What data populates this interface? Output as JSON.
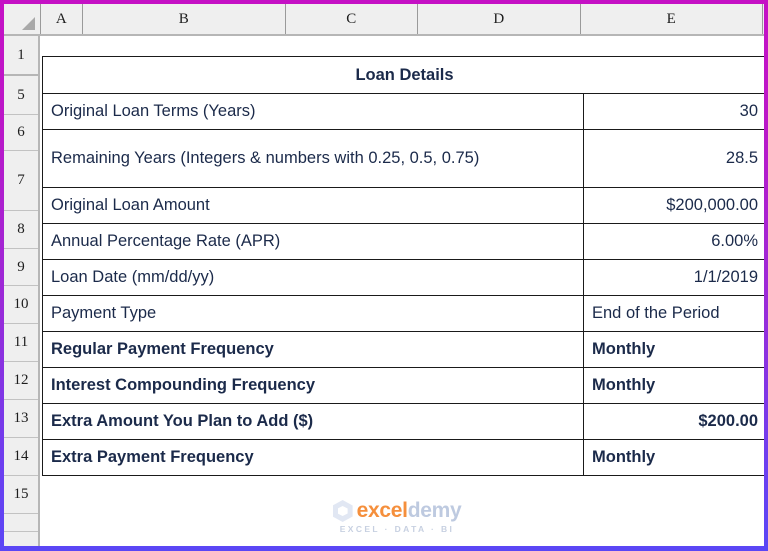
{
  "spreadsheet": {
    "column_headers": [
      "A",
      "B",
      "C",
      "D",
      "E"
    ],
    "row_headers": [
      "1",
      "5",
      "6",
      "7",
      "8",
      "9",
      "10",
      "11",
      "12",
      "13",
      "14",
      "15"
    ],
    "select_all_icon": "select-all-triangle"
  },
  "table": {
    "title": "Loan Details",
    "title_bg": "#FBE1A0",
    "highlight_color": "#FA8B12",
    "text_color": "#1B2A4A",
    "rows": [
      {
        "label": "Original Loan Terms (Years)",
        "value": "30",
        "highlight": false,
        "align": "right",
        "tall": false
      },
      {
        "label": "Remaining Years (Integers & numbers with 0.25, 0.5, 0.75)",
        "value": "28.5",
        "highlight": false,
        "align": "right",
        "tall": true
      },
      {
        "label": "Original Loan Amount",
        "value": "$200,000.00",
        "highlight": false,
        "align": "right",
        "tall": false
      },
      {
        "label": "Annual Percentage Rate (APR)",
        "value": "6.00%",
        "highlight": false,
        "align": "right",
        "tall": false
      },
      {
        "label": "Loan Date (mm/dd/yy)",
        "value": "1/1/2019",
        "highlight": false,
        "align": "right",
        "tall": false
      },
      {
        "label": "Payment Type",
        "value": "End of the Period",
        "highlight": false,
        "align": "left",
        "tall": false
      },
      {
        "label": "Regular Payment Frequency",
        "value": "Monthly",
        "highlight": true,
        "align": "left",
        "tall": false
      },
      {
        "label": "Interest Compounding Frequency",
        "value": "Monthly",
        "highlight": true,
        "align": "left",
        "tall": false
      },
      {
        "label": "Extra Amount You Plan to Add ($)",
        "value": "$200.00",
        "highlight": true,
        "align": "right",
        "tall": false
      },
      {
        "label": "Extra Payment Frequency",
        "value": "Monthly",
        "highlight": true,
        "align": "left",
        "tall": false
      }
    ]
  },
  "watermark": {
    "name_part1": "excel",
    "name_part2": "demy",
    "tagline": "EXCEL · DATA · BI"
  }
}
